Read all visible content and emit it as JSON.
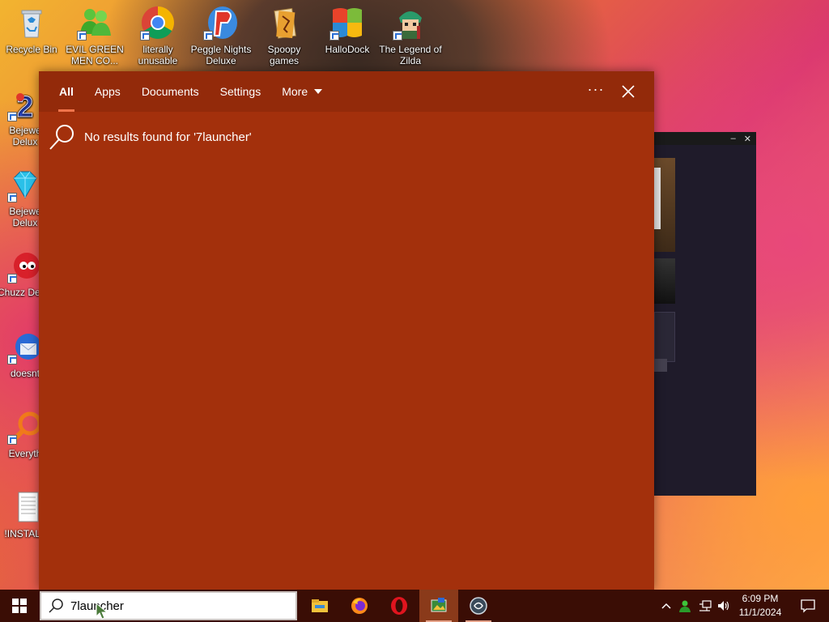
{
  "desktop": {
    "top_icons": [
      {
        "label": "Recycle Bin",
        "icon": "recycle-bin-icon"
      },
      {
        "label": "EVIL GREEN MEN CO...",
        "icon": "messenger-icon"
      },
      {
        "label": "literally unusable",
        "icon": "chrome-icon"
      },
      {
        "label": "Peggle Nights Deluxe",
        "icon": "peggle-icon"
      },
      {
        "label": "Spoopy games",
        "icon": "folder-icon"
      },
      {
        "label": "HalloDock",
        "icon": "windows-logo-icon"
      },
      {
        "label": "The Legend of Zilda",
        "icon": "zelda-icon"
      }
    ],
    "left_icons": [
      {
        "label": "Bejewe Delux",
        "icon": "bejeweled2-icon"
      },
      {
        "label": "Bejewe Delux",
        "icon": "bejeweled-icon"
      },
      {
        "label": "Chuzz Delux",
        "icon": "chuzzle-icon"
      },
      {
        "label": "doesnt",
        "icon": "thunderbird-icon"
      },
      {
        "label": "Everyth",
        "icon": "everything-search-icon"
      },
      {
        "label": "!INSTALL",
        "icon": "text-file-icon"
      }
    ]
  },
  "background_window": {
    "minimize": "–",
    "close": "✕"
  },
  "search_panel": {
    "tabs": [
      {
        "label": "All",
        "active": true
      },
      {
        "label": "Apps"
      },
      {
        "label": "Documents"
      },
      {
        "label": "Settings"
      },
      {
        "label": "More"
      }
    ],
    "ellipsis": "···",
    "no_results_text": "No results found for '7launcher'",
    "accent_color": "#f0744b",
    "panel_color": "#a3300c"
  },
  "taskbar": {
    "search_value": "7launcher",
    "pinned_apps": [
      {
        "name": "file-explorer-icon",
        "running": false
      },
      {
        "name": "firefox-icon",
        "running": false
      },
      {
        "name": "opera-icon",
        "running": false
      },
      {
        "name": "photo-app-icon",
        "running": true,
        "active": true
      },
      {
        "name": "launcher-icon",
        "running": true
      }
    ],
    "clock_time": "6:09 PM",
    "clock_date": "11/1/2024"
  }
}
